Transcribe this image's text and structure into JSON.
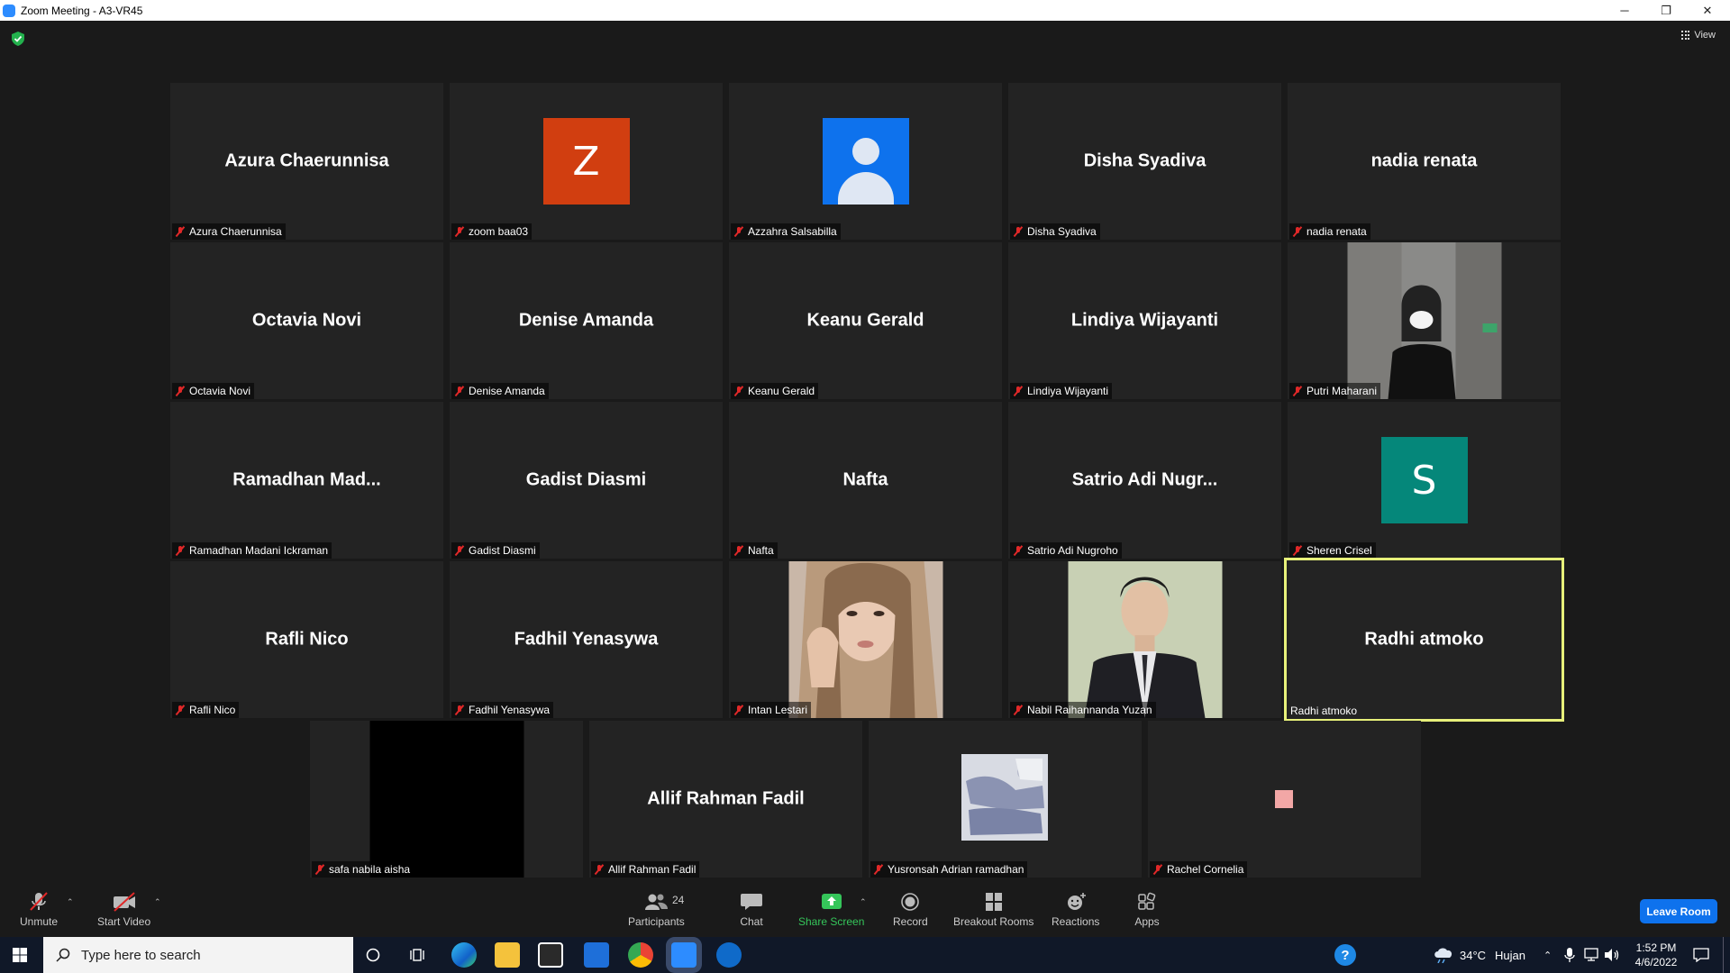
{
  "window": {
    "title": "Zoom Meeting - A3-VR45",
    "minimize": "─",
    "restore": "❐",
    "close": "✕"
  },
  "meeting": {
    "view_label": "View"
  },
  "colors": {
    "tile_bg": "#232323",
    "stage_bg": "#1a1a1a",
    "active_speaker": "#e7f07a",
    "avatar_blue": "#0e72ed",
    "avatar_orange": "#d13e10",
    "avatar_teal": "#05877a",
    "share_green": "#35c55a",
    "leave_blue": "#0e72ed"
  },
  "participants": [
    {
      "display": "Azura Chaerunnisa",
      "label": "Azura Chaerunnisa",
      "muted": true
    },
    {
      "avatar_letter": "Z",
      "avatar_color": "#d13e10",
      "label": "zoom baa03",
      "muted": true
    },
    {
      "avatar": "person-icon",
      "label": "Azzahra Salsabilla",
      "muted": true
    },
    {
      "display": "Disha Syadiva",
      "label": "Disha Syadiva",
      "muted": true
    },
    {
      "display": "nadia renata",
      "label": "nadia renata",
      "muted": true
    },
    {
      "display": "Octavia Novi",
      "label": "Octavia Novi",
      "muted": true
    },
    {
      "display": "Denise Amanda",
      "label": "Denise Amanda",
      "muted": true
    },
    {
      "display": "Keanu Gerald",
      "label": "Keanu Gerald",
      "muted": true
    },
    {
      "display": "Lindiya Wijayanti",
      "label": "Lindiya Wijayanti",
      "muted": true
    },
    {
      "video": true,
      "label": "Putri Maharani",
      "muted": true
    },
    {
      "display": "Ramadhan  Mad...",
      "label": "Ramadhan Madani Ickraman",
      "muted": true
    },
    {
      "display": "Gadist Diasmi",
      "label": "Gadist Diasmi",
      "muted": true
    },
    {
      "display": "Nafta",
      "label": "Nafta",
      "muted": true
    },
    {
      "display": "Satrio  Adi  Nugr...",
      "label": "Satrio Adi Nugroho",
      "muted": true
    },
    {
      "avatar_letter": "S",
      "avatar_color": "#05877a",
      "label": "Sheren Crisel",
      "muted": true
    },
    {
      "display": "Rafli Nico",
      "label": "Rafli Nico",
      "muted": true
    },
    {
      "display": "Fadhil Yenasywa",
      "label": "Fadhil Yenasywa",
      "muted": true
    },
    {
      "video": true,
      "label": "Intan Lestari",
      "muted": true
    },
    {
      "video": true,
      "label": "Nabil Raihannanda Yuzan",
      "muted": true
    },
    {
      "display": "Radhi atmoko",
      "label": "Radhi atmoko",
      "muted": false,
      "active": true
    },
    {
      "video": true,
      "label": "safa nabila aisha",
      "muted": true
    },
    {
      "display": "Allif Rahman Fadil",
      "label": "Allif Rahman Fadil",
      "muted": true
    },
    {
      "video": true,
      "label": "Yusronsah Adrian ramadhan",
      "muted": true
    },
    {
      "video": true,
      "label": "Rachel Cornelia",
      "muted": true
    }
  ],
  "toolbar": {
    "unmute": "Unmute",
    "start_video": "Start Video",
    "participants": "Participants",
    "participants_count": "24",
    "chat": "Chat",
    "share_screen": "Share Screen",
    "record": "Record",
    "breakout_rooms": "Breakout Rooms",
    "reactions": "Reactions",
    "apps": "Apps",
    "leave": "Leave Room"
  },
  "taskbar": {
    "search_placeholder": "Type here to search",
    "weather_temp": "34°C",
    "weather_desc": "Hujan",
    "time": "1:52 PM",
    "date": "4/6/2022"
  }
}
